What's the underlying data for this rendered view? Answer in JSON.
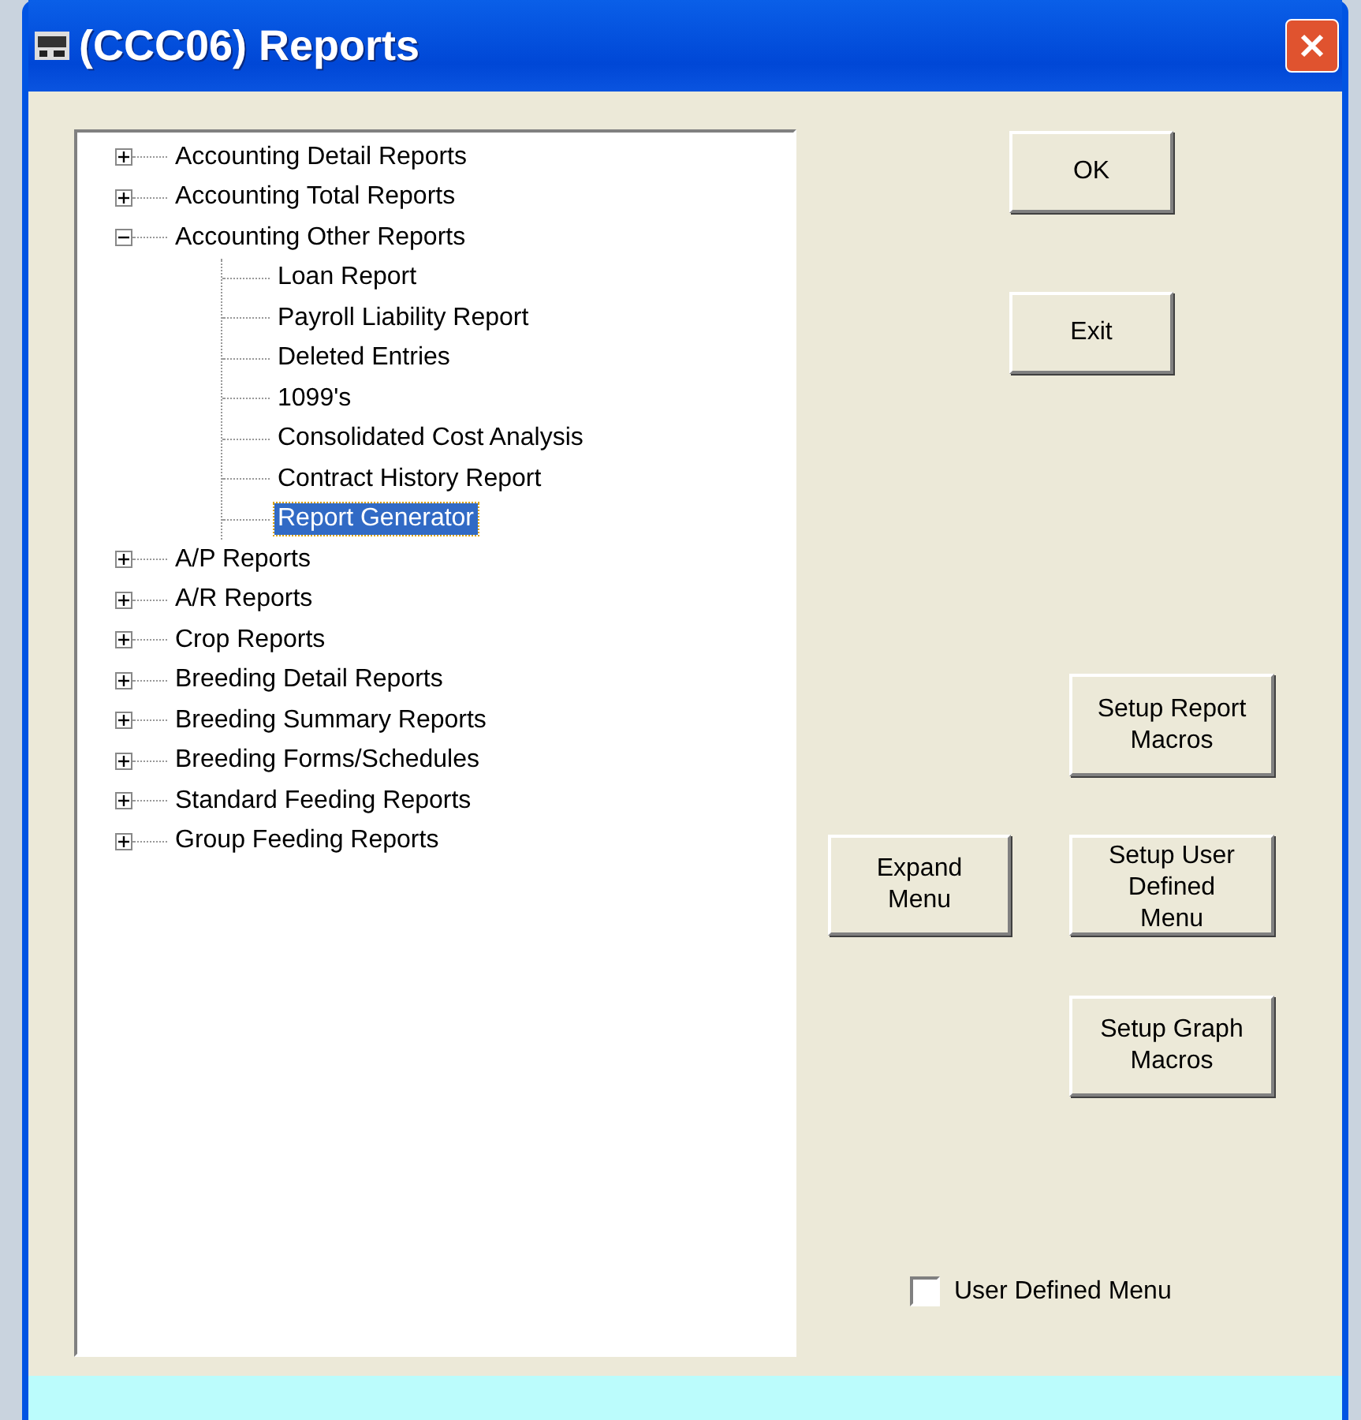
{
  "window": {
    "title": "(CCC06)  Reports"
  },
  "tree": [
    {
      "label": "Accounting Detail Reports",
      "expanded": false,
      "selected": false
    },
    {
      "label": "Accounting Total Reports",
      "expanded": false,
      "selected": false
    },
    {
      "label": "Accounting Other Reports",
      "expanded": true,
      "selected": false,
      "children": [
        {
          "label": "Loan Report",
          "selected": false
        },
        {
          "label": "Payroll Liability Report",
          "selected": false
        },
        {
          "label": "Deleted Entries",
          "selected": false
        },
        {
          "label": "1099's",
          "selected": false
        },
        {
          "label": "Consolidated Cost Analysis",
          "selected": false
        },
        {
          "label": "Contract History Report",
          "selected": false
        },
        {
          "label": "Report Generator",
          "selected": true
        }
      ]
    },
    {
      "label": "A/P  Reports",
      "expanded": false,
      "selected": false
    },
    {
      "label": "A/R  Reports",
      "expanded": false,
      "selected": false
    },
    {
      "label": "Crop Reports",
      "expanded": false,
      "selected": false
    },
    {
      "label": "Breeding Detail Reports",
      "expanded": false,
      "selected": false
    },
    {
      "label": "Breeding Summary Reports",
      "expanded": false,
      "selected": false
    },
    {
      "label": "Breeding Forms/Schedules",
      "expanded": false,
      "selected": false
    },
    {
      "label": "Standard Feeding Reports",
      "expanded": false,
      "selected": false
    },
    {
      "label": "Group Feeding Reports",
      "expanded": false,
      "selected": false
    }
  ],
  "buttons": [
    {
      "label": "OK",
      "kind": "ok"
    },
    {
      "label": "Exit",
      "kind": "exit"
    },
    {
      "label": "Setup Report Macros",
      "kind": "report_macros"
    },
    {
      "label": "Expand Menu",
      "kind": "expand"
    },
    {
      "label": "Setup User Defined Menu",
      "kind": "user_menu"
    },
    {
      "label": "Setup Graph Macros",
      "kind": "graph_macros"
    }
  ],
  "user_defined_menu": {
    "label": "User Defined Menu",
    "checked": false
  }
}
